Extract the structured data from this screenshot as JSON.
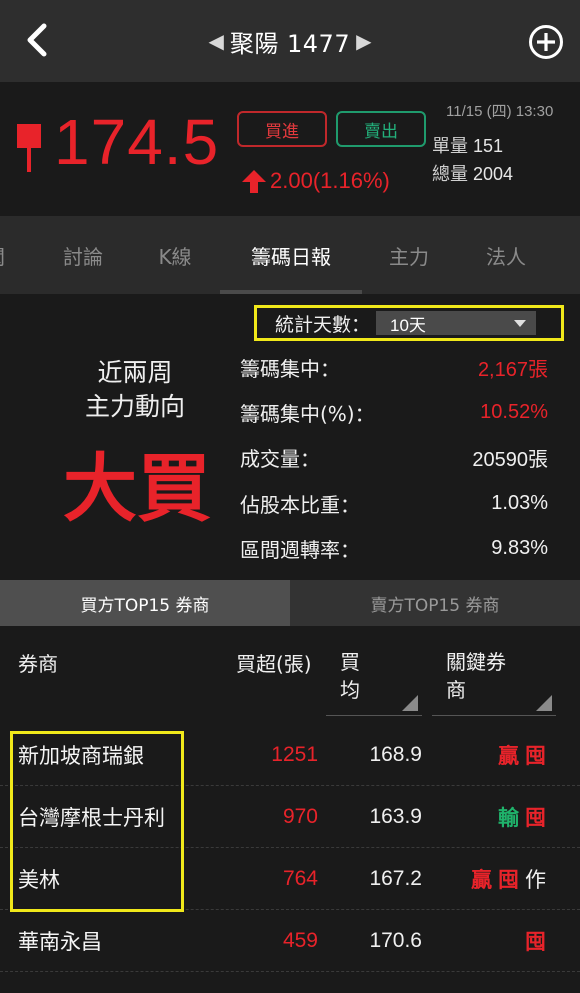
{
  "header": {
    "title": "聚陽 1477",
    "prev_symbol": "◀",
    "next_symbol": "▶"
  },
  "quote": {
    "price": "174.5",
    "buy_label": "買進",
    "sell_label": "賣出",
    "change": "2.00(1.16%)",
    "timestamp": "11/15 (四) 13:30",
    "unit_volume_label": "單量",
    "unit_volume": "151",
    "total_volume_label": "總量",
    "total_volume": "2004",
    "price_color": "#e8232a"
  },
  "tabs": [
    {
      "label": "聞"
    },
    {
      "label": "討論"
    },
    {
      "label": "K線"
    },
    {
      "label": "籌碼日報"
    },
    {
      "label": "主力"
    },
    {
      "label": "法人"
    }
  ],
  "summary": {
    "days_label": "統計天數：",
    "days_value": "10天",
    "trend_line1": "近兩周",
    "trend_line2": "主力動向",
    "trend_value": "大買",
    "rows": [
      {
        "label": "籌碼集中：",
        "value": "2,167張"
      },
      {
        "label": "籌碼集中(%)：",
        "value": "10.52%"
      },
      {
        "label": "成交量：",
        "value": "20590張"
      },
      {
        "label": "佔股本比重：",
        "value": "1.03%"
      },
      {
        "label": "區間週轉率：",
        "value": "9.83%"
      }
    ]
  },
  "subtabs": {
    "buy": "買方TOP15 券商",
    "sell": "賣方TOP15 券商"
  },
  "table": {
    "headers": {
      "broker": "券商",
      "net_buy": "買超(張)",
      "avg_line1": "買",
      "avg_line2": "均",
      "key_line1": "關鍵券",
      "key_line2": "商"
    },
    "rows": [
      {
        "broker": "新加坡商瑞銀",
        "net": "1251",
        "avg": "168.9",
        "tag1": "贏",
        "tag2": "囤",
        "tag3": ""
      },
      {
        "broker": "台灣摩根士丹利",
        "net": "970",
        "avg": "163.9",
        "tag1": "輸",
        "tag2": "囤",
        "tag3": ""
      },
      {
        "broker": "美林",
        "net": "764",
        "avg": "167.2",
        "tag1": "贏",
        "tag2": "囤",
        "tag3": "作"
      },
      {
        "broker": "華南永昌",
        "net": "459",
        "avg": "170.6",
        "tag1": "",
        "tag2": "囤",
        "tag3": ""
      }
    ]
  }
}
